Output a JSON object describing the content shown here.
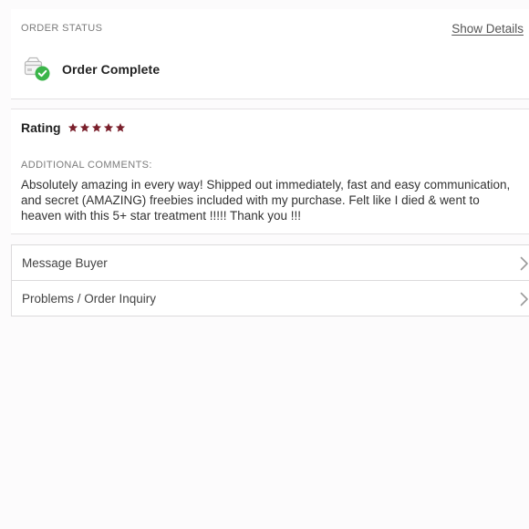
{
  "order_status": {
    "heading": "ORDER STATUS",
    "show_details_label": "Show Details",
    "status_text": "Order Complete",
    "status_icon": "package-check-icon"
  },
  "rating": {
    "label": "Rating",
    "stars": 5,
    "max_stars": 5,
    "star_color": "#7a1f2b"
  },
  "comments": {
    "heading": "ADDITIONAL COMMENTS:",
    "text": "Absolutely amazing in every way! Shipped out immediately, fast and easy communication, and secret (AMAZING) freebies included with my purchase. Felt like I died & went to heaven with this 5+ star treatment !!!!! Thank you !!!"
  },
  "actions": [
    {
      "label": "Message Buyer",
      "icon": "chevron-right-icon"
    },
    {
      "label": "Problems / Order Inquiry",
      "icon": "chevron-right-icon"
    }
  ],
  "colors": {
    "accent_green": "#3bb54a",
    "star": "#7a1f2b",
    "background": "#fcfbfc"
  }
}
